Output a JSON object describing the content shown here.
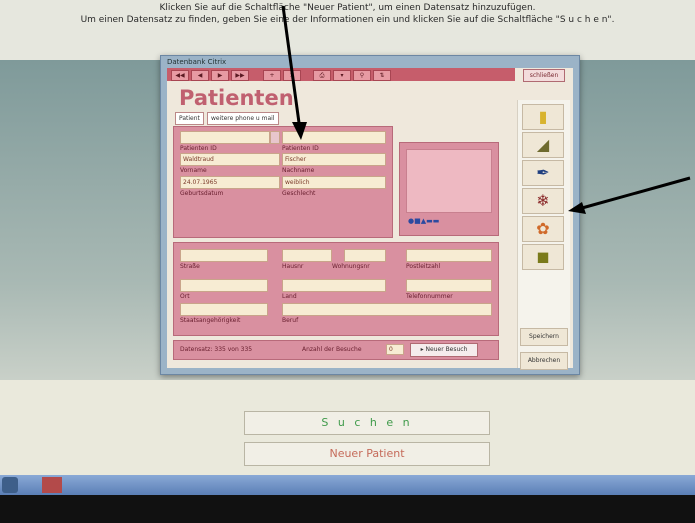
{
  "instructions": {
    "line1": "Klicken Sie auf die Schaltfläche \"Neuer Patient\", um einen Datensatz hinzuzufügen.",
    "line2": "Um einen Datensatz zu finden, geben Sie eine der Informationen ein und klicken Sie auf die Schaltfläche \"S u c h e n\"."
  },
  "window": {
    "title": "Datenbank Citrix"
  },
  "form": {
    "title": "Patienten",
    "close_label": "schließen",
    "tabs": [
      "Patient",
      "weitere phone u mail"
    ],
    "labels": {
      "patient_id": "Patienten ID",
      "vorname": "Vorname",
      "geburtsdatum": "Geburtsdatum",
      "patient_nr": "Patienten ID",
      "nachname": "Nachname",
      "geschlecht": "Geschlecht",
      "strasse": "Straße",
      "hausnr": "Hausnr",
      "wohnungsnr": "Wohnungsnr",
      "postleitzahl": "Postleitzahl",
      "ort": "Ort",
      "land": "Land",
      "telefonnummer": "Telefonnummer",
      "staatsangehoerigkeit": "Staatsangehörigkeit",
      "beruf": "Beruf"
    },
    "values": {
      "vorname": "Waldtraud",
      "geburtsdatum": "24.07.1965",
      "nachname": "Fischer",
      "geschlecht": "weiblich"
    },
    "status": {
      "record_text": "Datensatz: 335 von 335",
      "visits_label": "Anzahl der Besuche",
      "visits_value": "0",
      "new_visit_label": "Neuer Besuch"
    },
    "sidebar": {
      "speichern": "Speichern",
      "abbrechen": "Abbrechen"
    }
  },
  "buttons": {
    "suchen": "S u c h e n",
    "neuer_patient": "Neuer Patient"
  },
  "colors": {
    "form_pink": "#d990a0",
    "title_pink": "#c06070",
    "field_bg": "#f7ecd3",
    "suchen_text": "#3f9a4a",
    "neuer_text": "#c56b5a"
  },
  "sidebar_icons": [
    "binder-icon",
    "book-icon",
    "pen-icon",
    "footprint-icon",
    "brain-icon",
    "cube-icon"
  ]
}
